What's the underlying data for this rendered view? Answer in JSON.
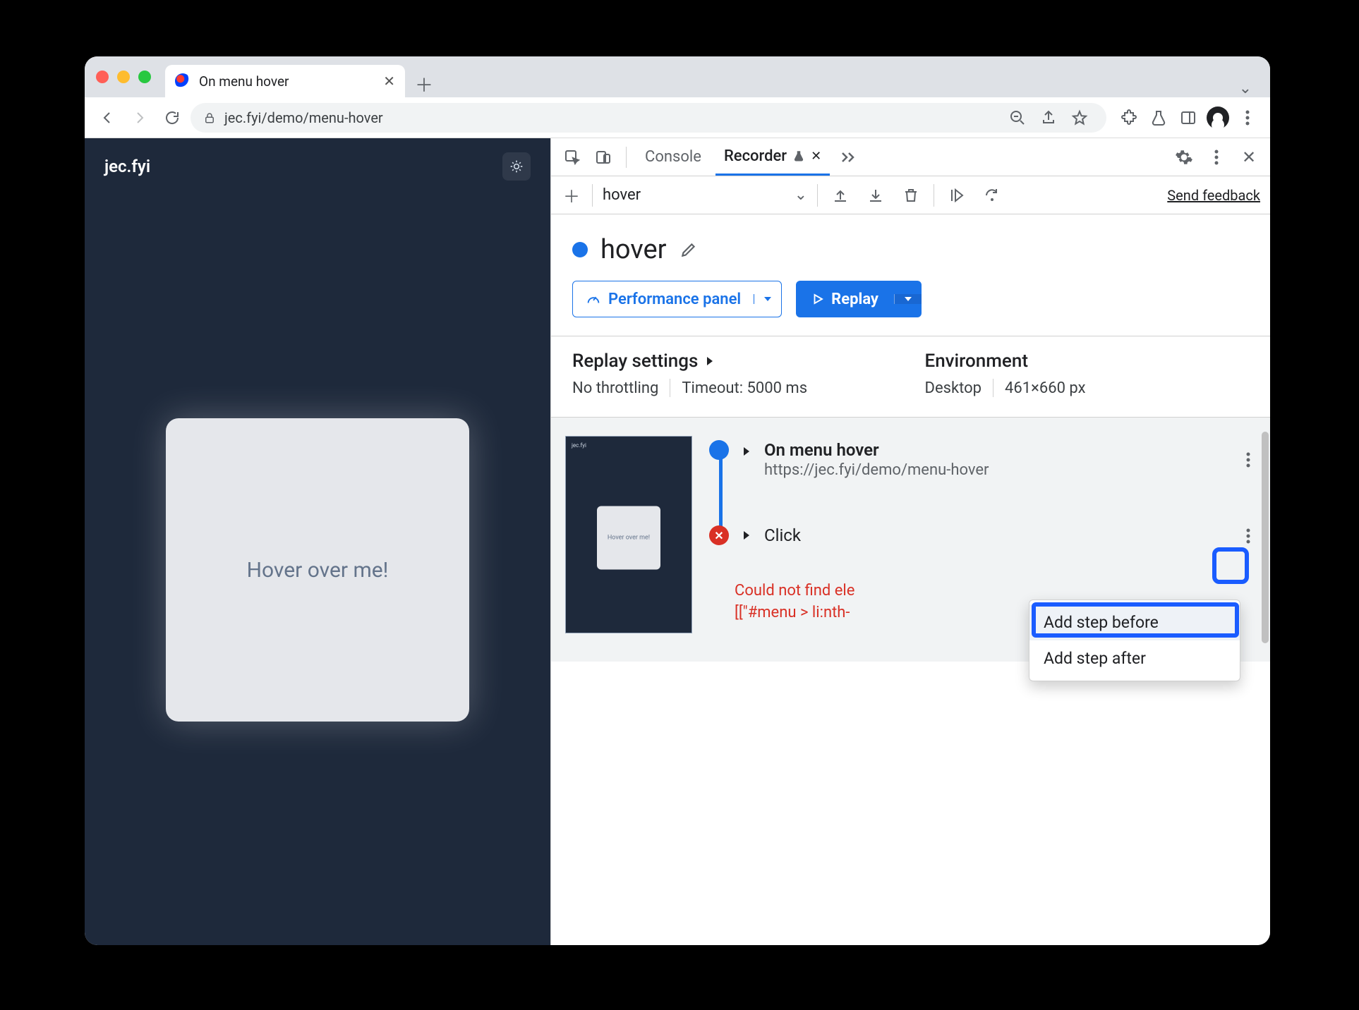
{
  "browser": {
    "tab_title": "On menu hover",
    "url": "jec.fyi/demo/menu-hover"
  },
  "page": {
    "site_name": "jec.fyi",
    "card_text": "Hover over me!"
  },
  "devtools": {
    "tabs": {
      "console": "Console",
      "recorder": "Recorder"
    },
    "toolbar": {
      "recording_selector": "hover",
      "send_feedback": "Send feedback"
    },
    "recording": {
      "name": "hover",
      "performance_btn": "Performance panel",
      "replay_btn": "Replay"
    },
    "settings": {
      "replay_label": "Replay settings",
      "throttling": "No throttling",
      "timeout": "Timeout: 5000 ms",
      "env_label": "Environment",
      "device": "Desktop",
      "viewport": "461×660 px"
    },
    "steps": {
      "s1_title": "On menu hover",
      "s1_url": "https://jec.fyi/demo/menu-hover",
      "s2_title": "Click",
      "error_l1": "Could not find ele",
      "error_l2": "[[\"#menu > li:nth-"
    },
    "menu": {
      "add_before": "Add step before",
      "add_after": "Add step after"
    },
    "thumb_text": "Hover over me!"
  }
}
